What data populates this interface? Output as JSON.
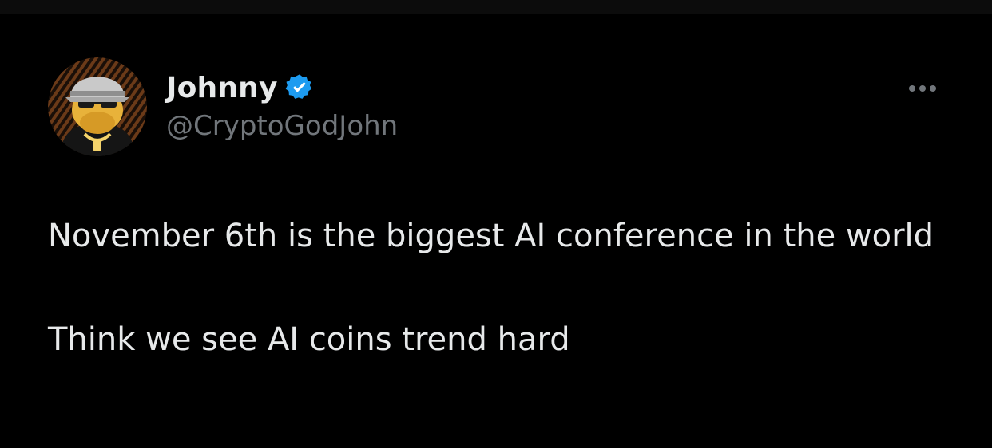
{
  "theme": {
    "background": "#000000",
    "text": "#e7e9ea",
    "secondary_text": "#71767b",
    "verified_blue": "#1d9bf0"
  },
  "author": {
    "display_name": "Johnny",
    "handle": "@CryptoGodJohn",
    "verified": true,
    "avatar_icon": "cartoon-avatar-icon"
  },
  "menu": {
    "icon": "more-options-icon"
  },
  "tweet": {
    "paragraphs": [
      "November 6th is the biggest AI conference in the world",
      "Think we see AI coins trend hard"
    ]
  }
}
